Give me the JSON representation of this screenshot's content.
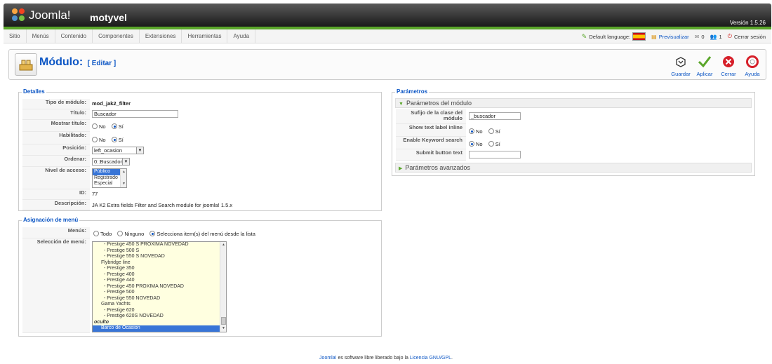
{
  "header": {
    "logo_text": "Joomla!",
    "site_name": "motyvel",
    "version": "Versión 1.5.26"
  },
  "menubar": {
    "items": [
      "Sitio",
      "Menús",
      "Contenido",
      "Componentes",
      "Extensiones",
      "Herramientas",
      "Ayuda"
    ],
    "default_language_label": "Default language:",
    "preview_label": "Previsualizar",
    "messages_count": "0",
    "users_count": "1",
    "logout_label": "Cerrar sesión"
  },
  "toolbar": {
    "title": "Módulo:",
    "subtitle": "[ Editar ]",
    "buttons": {
      "save": "Guardar",
      "apply": "Aplicar",
      "close": "Cerrar",
      "help": "Ayuda"
    }
  },
  "details": {
    "legend": "Detalles",
    "module_type_label": "Tipo de módulo:",
    "module_type_value": "mod_jak2_filter",
    "title_label": "Título:",
    "title_value": "Buscador",
    "show_title_label": "Mostrar título:",
    "enabled_label": "Habilitado:",
    "no_label": "No",
    "yes_label": "Sí",
    "position_label": "Posición:",
    "position_value": "left_ocasion",
    "order_label": "Ordenar:",
    "order_value": "0::Buscador",
    "access_label": "Nivel de acceso:",
    "access_options": [
      "Público",
      "Registrado",
      "Especial"
    ],
    "id_label": "ID:",
    "id_value": "77",
    "description_label": "Descripción:",
    "description_value": "JA K2 Extra fields Filter and Search module for joomla! 1.5.x"
  },
  "menu_assignment": {
    "legend": "Asignación de menú",
    "menus_label": "Menús:",
    "all_label": "Todo",
    "none_label": "Ninguno",
    "select_label": "Selecciona item(s) del menú desde la lista",
    "selection_label": "Selección de menú:",
    "list_items": [
      "- Prestige 450 S PROXIMA NOVEDAD",
      "- Prestige 500 S",
      "- Prestige 550 S NOVEDAD",
      "Flybridge line",
      "- Prestige 350",
      "- Prestige 400",
      "- Prestige 440",
      "- Prestige 450 PROXIMA NOVEDAD",
      "- Prestige 500",
      "- Prestige 550 NOVEDAD",
      "Gama Yachts",
      "- Prestige 620",
      "- Prestige 620S NOVEDAD",
      "oculto",
      "Barco de Ocasion"
    ]
  },
  "params": {
    "legend": "Parámetros",
    "module_params_header": "Parámetros del módulo",
    "suffix_label": "Sufijo de la clase del módulo",
    "suffix_value": "_buscador",
    "show_text_label": "Show text label inline",
    "enable_keyword_label": "Enable Keyword search",
    "submit_text_label": "Submit button text",
    "submit_text_value": "",
    "advanced_header": "Parámetros avanzados",
    "no_label": "No",
    "yes_label": "Sí"
  },
  "footer": {
    "joomla_link": "Joomla!",
    "text": " es software libre liberado bajo la ",
    "license_link": "Licencia GNU/GPL",
    "end": "."
  },
  "colors": {
    "accent": "#0b55c4",
    "green": "#5aa62a",
    "header_dark": "#1a1a1a",
    "selection": "#3875d7",
    "listbox_bg": "#ffffe0"
  }
}
